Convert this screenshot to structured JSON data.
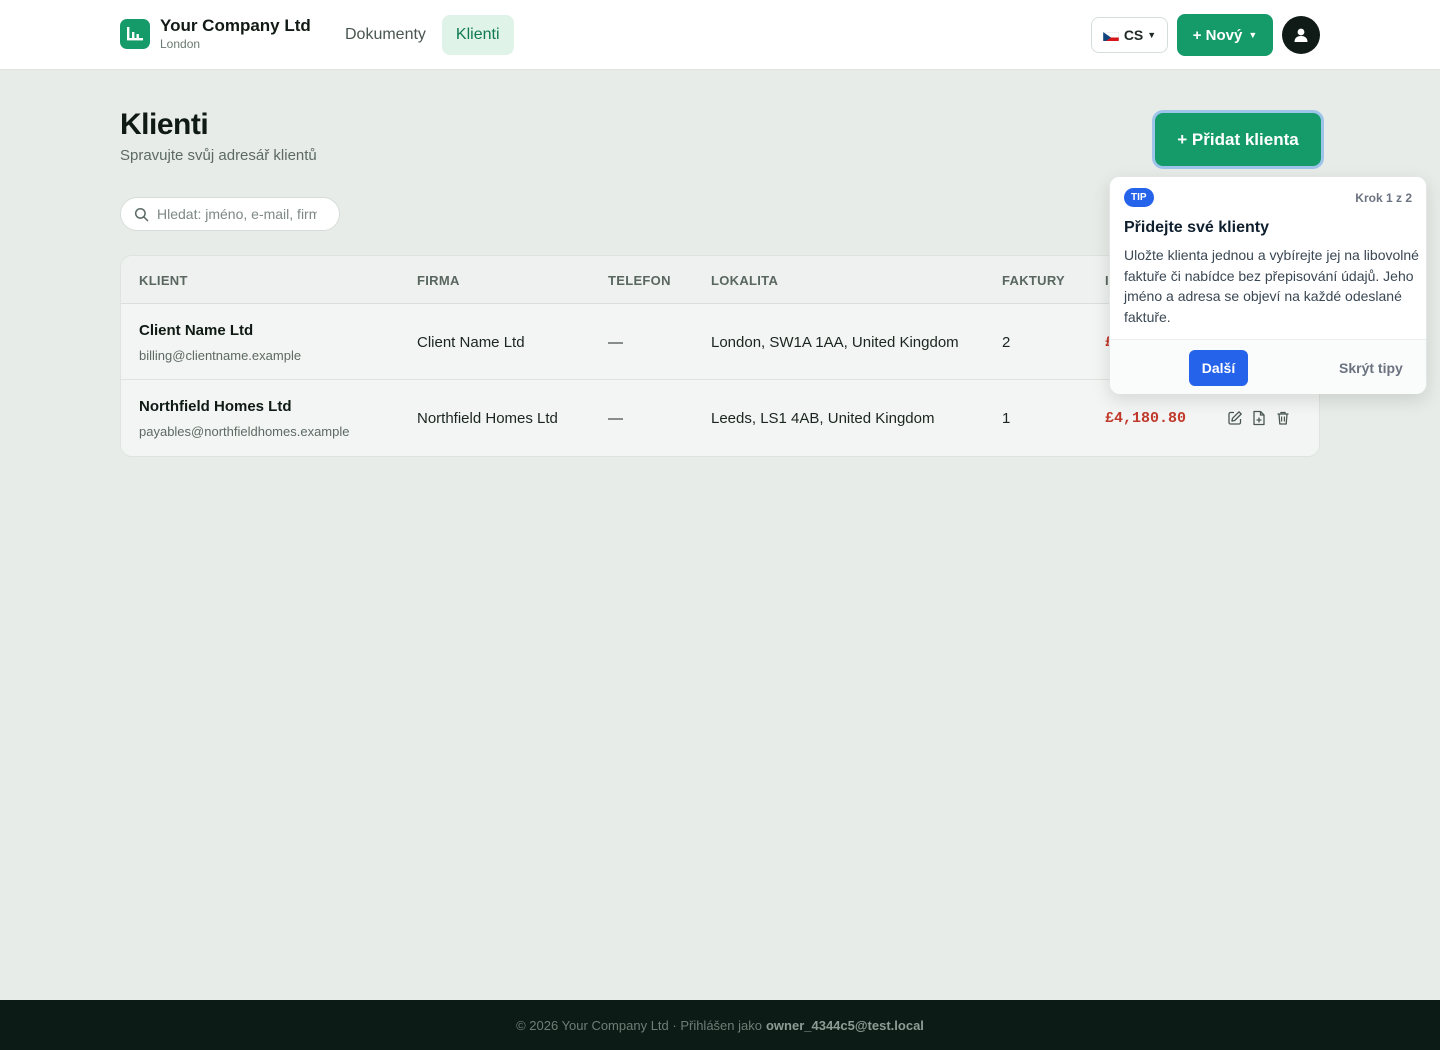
{
  "header": {
    "company_name": "Your Company Ltd",
    "company_city": "London",
    "nav": [
      {
        "label": "Dokumenty"
      },
      {
        "label": "Klienti"
      }
    ],
    "language_label": "CS",
    "new_button_label": "+ Nový",
    "brand_color": "#159b6a"
  },
  "page": {
    "title": "Klienti",
    "subtitle": "Spravujte svůj adresář klientů",
    "add_button_label": "+ Přidat klienta",
    "search_placeholder": "Hledat: jméno, e-mail, firma"
  },
  "table": {
    "columns": [
      "KLIENT",
      "FIRMA",
      "TELEFON",
      "LOKALITA",
      "FAKTURY",
      "I"
    ],
    "rows": [
      {
        "name": "Client Name Ltd",
        "email": "billing@clientname.example",
        "company": "Client Name Ltd",
        "phone": "—",
        "location": "London, SW1A 1AA, United Kingdom",
        "invoices": "2",
        "amount": "£"
      },
      {
        "name": "Northfield Homes Ltd",
        "email": "payables@northfieldhomes.example",
        "company": "Northfield Homes Ltd",
        "phone": "—",
        "location": "Leeds, LS1 4AB, United Kingdom",
        "invoices": "1",
        "amount": "£4,180.80"
      }
    ]
  },
  "tip": {
    "badge": "TIP",
    "step": "Krok 1 z 2",
    "title": "Přidejte své klienty",
    "body": "Uložte klienta jednou a vybírejte jej na libovolné faktuře či nabídce bez přepisování údajů. Jeho jméno a adresa se objeví na každé odeslané faktuře.",
    "next_label": "Další",
    "hide_label": "Skrýt tipy",
    "accent": "#2563eb"
  },
  "footer": {
    "text": "© 2026 Your Company Ltd · Přihlášen jako",
    "user": "owner_4344c5@test.local"
  }
}
